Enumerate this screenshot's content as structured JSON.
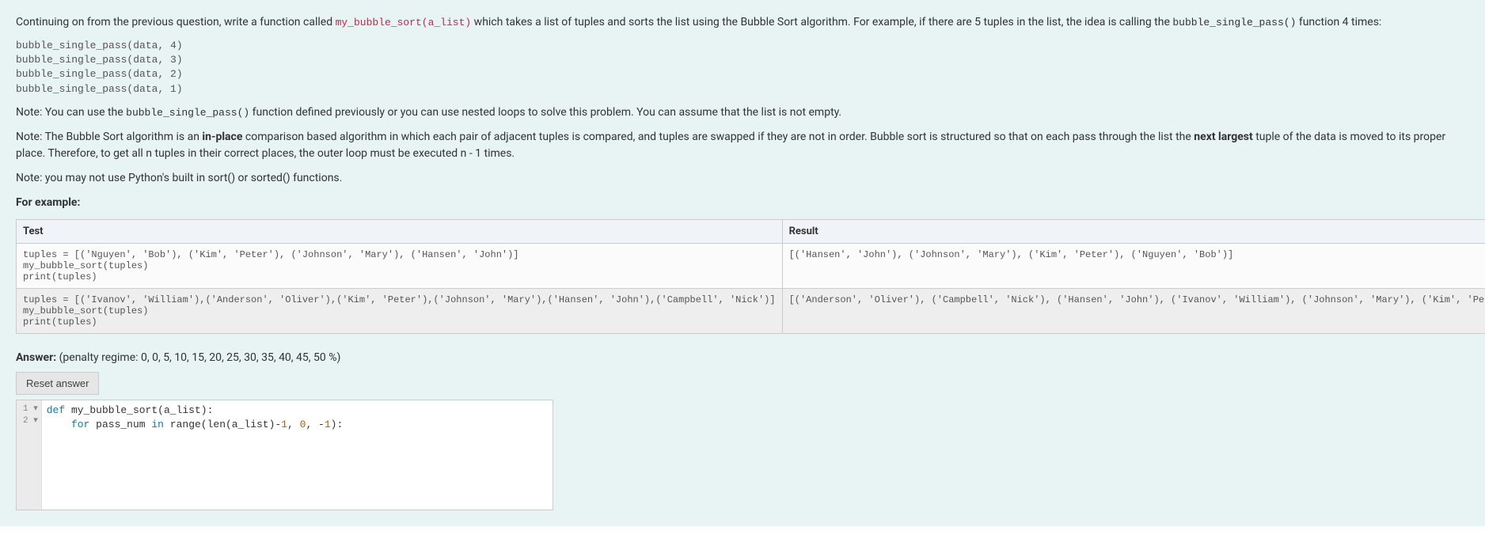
{
  "question": {
    "intro_prefix": "Continuing on from the previous question, write a function called ",
    "intro_code": "my_bubble_sort(a_list)",
    "intro_mid": " which takes a list of tuples and sorts the list using the Bubble Sort algorithm. For example, if there are 5 tuples in the list, the idea is calling the ",
    "intro_code2": "bubble_single_pass()",
    "intro_suffix": " function 4 times:",
    "example_calls": "bubble_single_pass(data, 4)\nbubble_single_pass(data, 3)\nbubble_single_pass(data, 2)\nbubble_single_pass(data, 1)",
    "note1_prefix": "Note: You can use the ",
    "note1_code": "bubble_single_pass()",
    "note1_suffix": " function defined previously or you can use nested loops to solve this problem. You can assume that the list is not empty.",
    "note2_prefix": "Note: The Bubble Sort algorithm is an ",
    "note2_bold1": "in-place",
    "note2_mid1": " comparison based algorithm in which each pair of adjacent tuples is compared, and tuples are swapped if they are not in order. Bubble sort is structured so that on each pass through the list the ",
    "note2_bold2": "next largest",
    "note2_mid2": " tuple of the data is moved to its proper place. Therefore, to get all n tuples in their correct places, the outer loop must be executed n - 1 times.",
    "note3": "Note: you may not use Python's built in sort() or sorted() functions.",
    "for_example": "For example:"
  },
  "table": {
    "headers": {
      "test": "Test",
      "result": "Result"
    },
    "rows": [
      {
        "test": "tuples = [('Nguyen', 'Bob'), ('Kim', 'Peter'), ('Johnson', 'Mary'), ('Hansen', 'John')]\nmy_bubble_sort(tuples)\nprint(tuples)",
        "result": "[('Hansen', 'John'), ('Johnson', 'Mary'), ('Kim', 'Peter'), ('Nguyen', 'Bob')]"
      },
      {
        "test": "tuples = [('Ivanov', 'William'),('Anderson', 'Oliver'),('Kim', 'Peter'),('Johnson', 'Mary'),('Hansen', 'John'),('Campbell', 'Nick')]\nmy_bubble_sort(tuples)\nprint(tuples)",
        "result": "[('Anderson', 'Oliver'), ('Campbell', 'Nick'), ('Hansen', 'John'), ('Ivanov', 'William'), ('Johnson', 'Mary'), ('Kim', 'Peter')]"
      }
    ]
  },
  "answer": {
    "label": "Answer:",
    "penalty": "(penalty regime: 0, 0, 5, 10, 15, 20, 25, 30, 35, 40, 45, 50 %)",
    "reset_label": "Reset answer"
  },
  "editor": {
    "gutter": [
      "1 ▾",
      "2 ▾"
    ],
    "line1": {
      "kw": "def",
      "rest": " my_bubble_sort(a_list):"
    },
    "line2": {
      "indent": "    ",
      "kw1": "for",
      "mid1": " pass_num ",
      "kw2": "in",
      "mid2": " range(len(a_list)-",
      "n1": "1",
      "c1": ", ",
      "n2": "0",
      "c2": ", -",
      "n3": "1",
      "end": "):"
    }
  }
}
